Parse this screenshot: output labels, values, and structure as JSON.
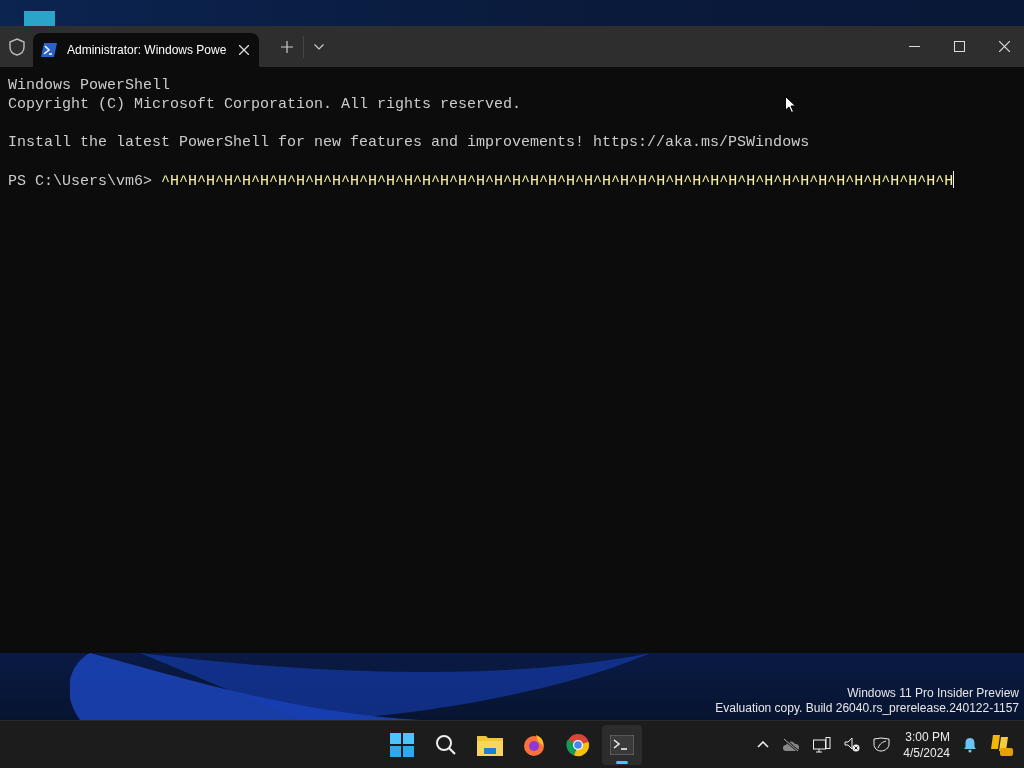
{
  "window": {
    "tab": {
      "title": "Administrator: Windows Powe",
      "selected": true
    }
  },
  "terminal": {
    "lines": [
      {
        "kind": "output",
        "text": "Windows PowerShell"
      },
      {
        "kind": "output",
        "text": "Copyright (C) Microsoft Corporation. All rights reserved."
      },
      {
        "kind": "blank"
      },
      {
        "kind": "output",
        "text": "Install the latest PowerShell for new features and improvements! https://aka.ms/PSWindows"
      },
      {
        "kind": "blank"
      },
      {
        "kind": "prompt",
        "prompt": "PS C:\\Users\\vm6>",
        "text": "^H^H^H^H^H^H^H^H^H^H^H^H^H^H^H^H^H^H^H^H^H^H^H^H^H^H^H^H^H^H^H^H^H^H^H^H^H^H^H^H^H^H^H^H"
      }
    ]
  },
  "watermark": {
    "edition": "Windows 11 Pro Insider Preview",
    "build": "Evaluation copy. Build 26040.rs_prerelease.240122-1157"
  },
  "taskbar": {
    "apps": [
      {
        "kind": "start",
        "active": false
      },
      {
        "kind": "search",
        "active": false
      },
      {
        "kind": "folder",
        "active": false
      },
      {
        "kind": "firefox",
        "active": false
      },
      {
        "kind": "chrome",
        "active": false
      },
      {
        "kind": "terminal",
        "active": true
      }
    ],
    "clock": {
      "time": "3:00 PM",
      "date": "4/5/2024"
    }
  }
}
